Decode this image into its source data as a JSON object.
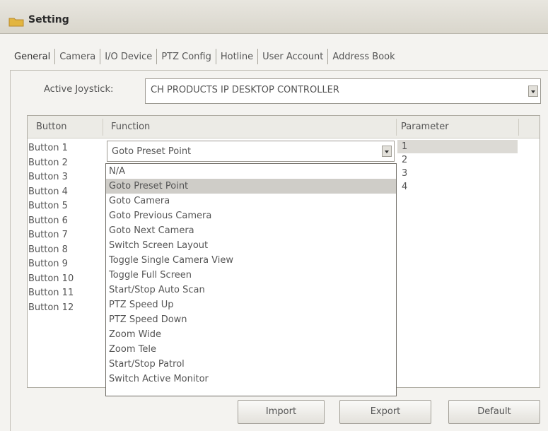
{
  "window": {
    "title": "Setting",
    "icon": "folder-icon"
  },
  "tabs": [
    {
      "label": "General"
    },
    {
      "label": "Camera"
    },
    {
      "label": "I/O Device"
    },
    {
      "label": "PTZ Config"
    },
    {
      "label": "Hotline"
    },
    {
      "label": "User Account"
    },
    {
      "label": "Address Book"
    }
  ],
  "joystick": {
    "label": "Active Joystick:",
    "value": "CH PRODUCTS IP DESKTOP CONTROLLER"
  },
  "table": {
    "headers": {
      "button": "Button",
      "function": "Function",
      "parameter": "Parameter"
    },
    "buttons": [
      "Button 1",
      "Button 2",
      "Button 3",
      "Button 4",
      "Button 5",
      "Button 6",
      "Button 7",
      "Button 8",
      "Button 9",
      "Button 10",
      "Button 11",
      "Button 12"
    ],
    "parameters": [
      "1",
      "2",
      "3",
      "4"
    ],
    "function_value": "Goto Preset Point"
  },
  "dropdown": {
    "options": [
      "N/A",
      "Goto Preset Point",
      "Goto Camera",
      "Goto Previous Camera",
      "Goto Next Camera",
      "Switch Screen Layout",
      "Toggle Single Camera View",
      "Toggle Full Screen",
      "Start/Stop Auto Scan",
      "PTZ Speed Up",
      "PTZ Speed Down",
      "Zoom Wide",
      "Zoom Tele",
      "Start/Stop Patrol",
      "Switch Active Monitor"
    ],
    "selected_index": 1
  },
  "actions": {
    "import": "Import",
    "export": "Export",
    "default": "Default"
  },
  "colors": {
    "selection": "#cfcdc8",
    "panel_bg": "#f4f3f0",
    "folder_icon": "#e2b540"
  }
}
